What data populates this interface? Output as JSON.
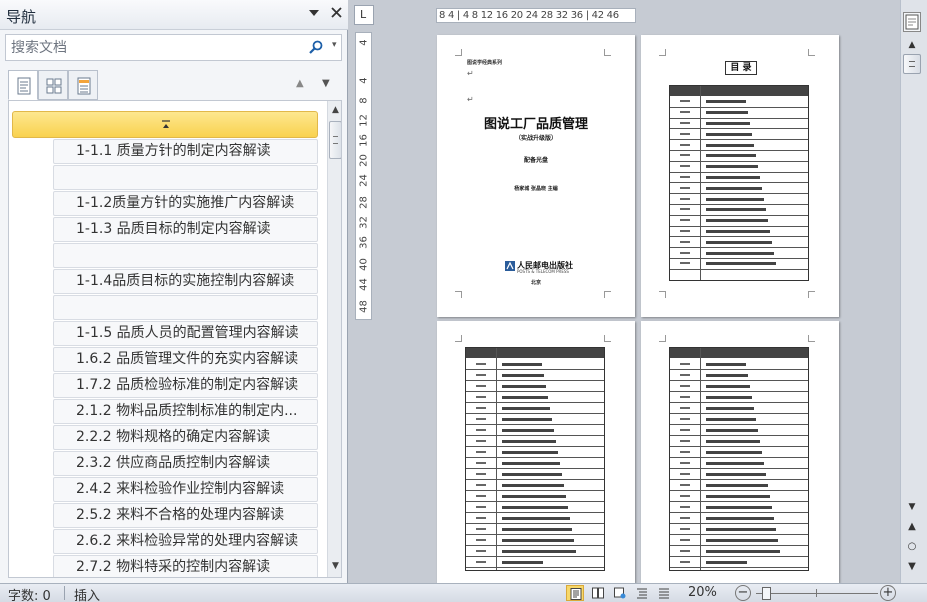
{
  "nav_pane": {
    "title": "导航",
    "search_placeholder": "搜索文档",
    "headings": [
      "1-1.1 质量方针的制定内容解读",
      "",
      "1-1.2质量方针的实施推广内容解读",
      "1-1.3 品质目标的制定内容解读",
      "",
      "1-1.4品质目标的实施控制内容解读",
      "",
      "1-1.5 品质人员的配置管理内容解读",
      "1.6.2 品质管理文件的充实内容解读",
      "1.7.2 品质检验标准的制定内容解读",
      "2.1.2 物料品质控制标准的制定内...",
      "2.2.2 物料规格的确定内容解读",
      "2.3.2 供应商品质控制内容解读",
      "2.4.2 来料检验作业控制内容解读",
      "2.5.2 来料不合格的处理内容解读",
      "2.6.2 来料检验异常的处理内容解读",
      "2.7.2 物料特采的控制内容解读"
    ],
    "icons": {
      "menu": "triangle-down",
      "close": "close-x",
      "search": "magnifier",
      "collapse": "collapse-up"
    },
    "accent_color": "#f9d24f"
  },
  "ruler": {
    "corner_symbol": "L",
    "horizontal_ticks": "8 4 | 4 8 12 16 20 24 28 32 36 | 42 46",
    "vertical_ticks": [
      "4",
      "4",
      "8",
      "12",
      "16",
      "20",
      "24",
      "28",
      "32",
      "36",
      "40",
      "44",
      "48"
    ]
  },
  "document": {
    "page1": {
      "series": "图说学经典系列",
      "title": "图说工厂品质管理",
      "subtitle": "（实战升级版）",
      "edition": "配备光盘",
      "authors": "杨家城 张晶晓 主编",
      "publisher": "人民邮电出版社",
      "publisher_en": "POSTS & TELECOM PRESS",
      "city": "北京"
    },
    "page2": {
      "toc_title": "目 录"
    }
  },
  "status_bar": {
    "word_count": "字数: 0",
    "mode": "插入",
    "zoom": "20%",
    "zoom_minus": "−",
    "zoom_plus": "+",
    "zoom_fraction": 0.05
  },
  "scrollbar": {
    "up": "▲",
    "down": "▼",
    "prev": "▲",
    "browse": "○",
    "next": "▼"
  }
}
